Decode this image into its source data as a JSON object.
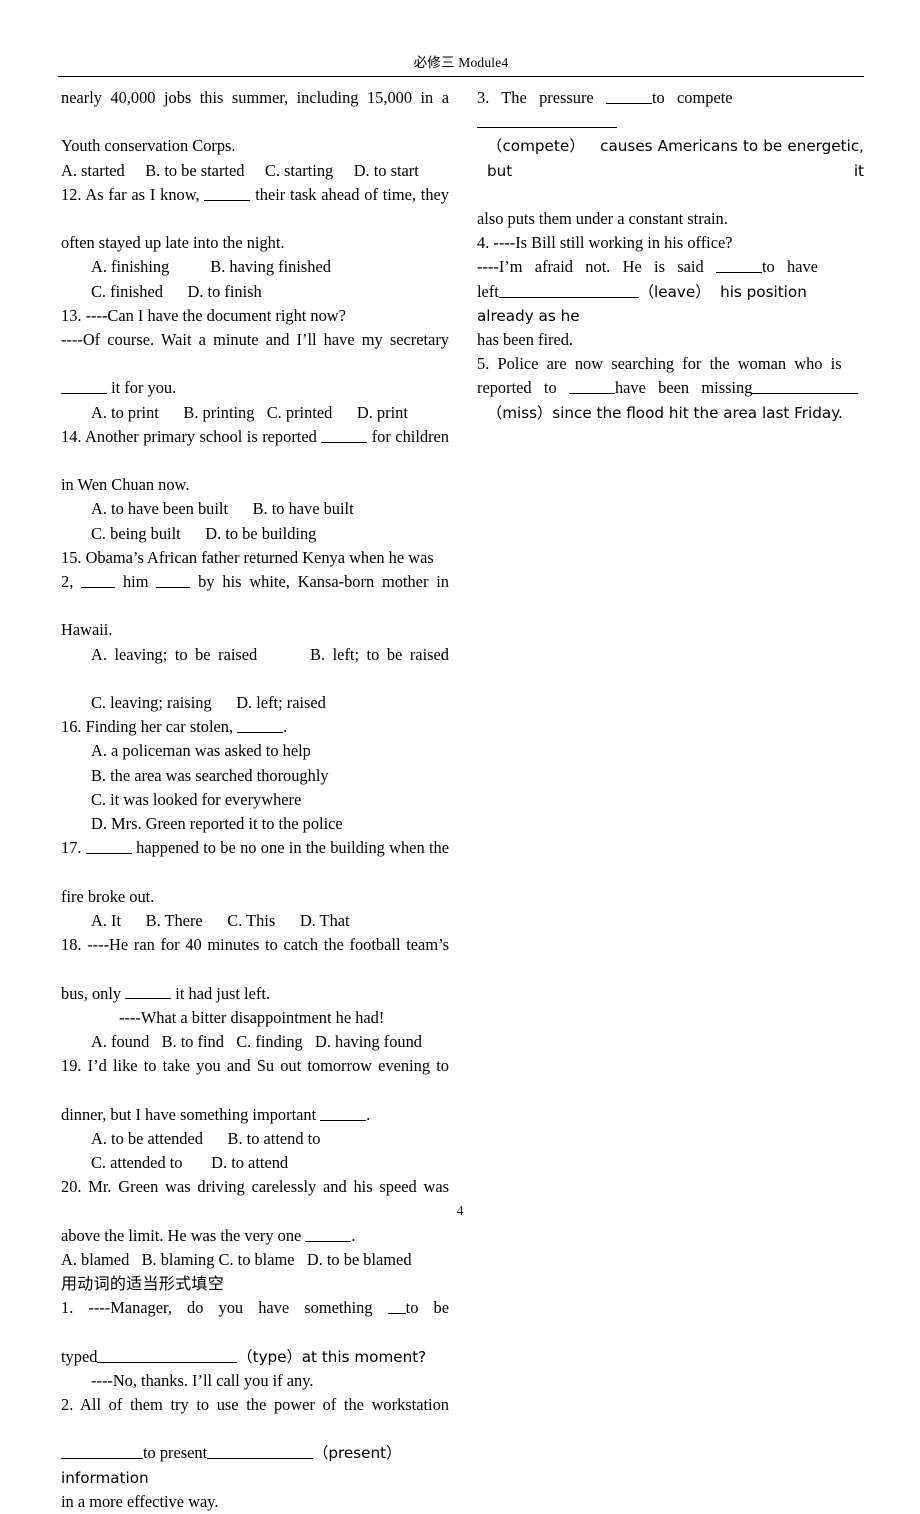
{
  "document": {
    "header_title": "必修三 Module4",
    "page_number": "4"
  },
  "left_column": {
    "q11_continued": {
      "stem_line1": "nearly 40,000 jobs this summer, including 15,000 in a",
      "stem_line2": "Youth conservation Corps.",
      "options": "A. started     B. to be started     C. starting     D. to start"
    },
    "q12": {
      "stem_a": "12. As far as I know, ",
      "stem_b": " their task ahead of time, they",
      "stem_line2": "often stayed up late into the night.",
      "options_line1": "A. finishing          B. having finished",
      "options_line2": "C. finished      D. to finish"
    },
    "q13": {
      "stem_line1": "13. ----Can I have the document right now?",
      "stem_line2": "----Of course. Wait a minute and I’ll have my secretary",
      "stem_line3_after_blank": " it for you.",
      "options": "A. to print      B. printing   C. printed      D. print"
    },
    "q14": {
      "stem_a": "14. Another primary school is reported ",
      "stem_b": " for children",
      "stem_line2": "in Wen Chuan now.",
      "options_line1": "A. to have been built      B. to have built",
      "options_line2": "C. being built      D. to be building"
    },
    "q15": {
      "stem_line1": "15. Obama’s African father returned Kenya when he was",
      "stem_line2_a": "2, ",
      "stem_line2_b": " him ",
      "stem_line2_c": " by his white, Kansa-born mother in",
      "stem_line3": "Hawaii.",
      "options_line1": "A. leaving; to be raised       B. left; to be raised",
      "options_line2": "C. leaving; raising      D. left; raised"
    },
    "q16": {
      "stem_a": "16. Finding her car stolen, ",
      "stem_b": ".",
      "option_a": "A. a policeman was asked to help",
      "option_b": "B. the area was searched thoroughly",
      "option_c": "C. it was looked for everywhere",
      "option_d": "D. Mrs. Green reported it to the police"
    },
    "q17": {
      "stem_a": "17. ",
      "stem_b": " happened to be no one in the building when the",
      "stem_line2": "fire broke out.",
      "options": "A. It      B. There      C. This      D. That"
    },
    "q18": {
      "stem_line1": "18. ----He ran for 40 minutes to catch the football team’s",
      "stem_line2_a": "bus, only ",
      "stem_line2_b": " it had just left.",
      "stem_line3": "----What a bitter disappointment he had!",
      "options": "A. found   B. to find   C. finding   D. having found"
    },
    "q19": {
      "stem_line1": "19. I’d like to take you and Su out tomorrow evening to",
      "stem_line2_a": "dinner, but I have something important ",
      "stem_line2_b": ".",
      "options_line1": "A. to be attended      B. to attend to",
      "options_line2": "C. attended to       D. to attend"
    },
    "q20": {
      "stem_line1": "20. Mr. Green was driving carelessly and his speed was",
      "stem_line2_a": "above the limit. He was the very one ",
      "stem_line2_b": ".",
      "options": "A. blamed   B. blaming C. to blame   D. to be blamed"
    },
    "section_heading": "用动词的适当形式填空",
    "f1": {
      "line1_a": "1. ----Manager, do you have something ",
      "line1_b": "to be",
      "line2_a": "typed",
      "line2_b": "（type）at this moment?",
      "line3": "----No, thanks. I’ll call you if any."
    },
    "f2": {
      "line1": "2. All of them try to use the power of the workstation",
      "line2_a": "to present",
      "line2_b": "（present）  information",
      "line3": "in a more effective way."
    }
  },
  "right_column": {
    "f3": {
      "line1_a": "3.   The   pressure   ",
      "line1_b": "to   compete",
      "line2": "（compete）   causes Americans to be energetic, but it",
      "line3": "also puts them under a constant strain."
    },
    "f4": {
      "line1": "4. ----Is Bill still working in his office?",
      "line2_a": "----I’m   afraid   not.   He   is   said   ",
      "line2_b": "to   have",
      "line3_a": "left",
      "line3_b": "（leave）  his position already as he",
      "line4": "has been fired."
    },
    "f5": {
      "line1": "5.  Police  are  now  searching  for  the  woman  who  is",
      "line2_a": "reported   to   ",
      "line2_b": "have   been   missing",
      "line3": "（miss）since the flood hit the area last Friday."
    }
  }
}
